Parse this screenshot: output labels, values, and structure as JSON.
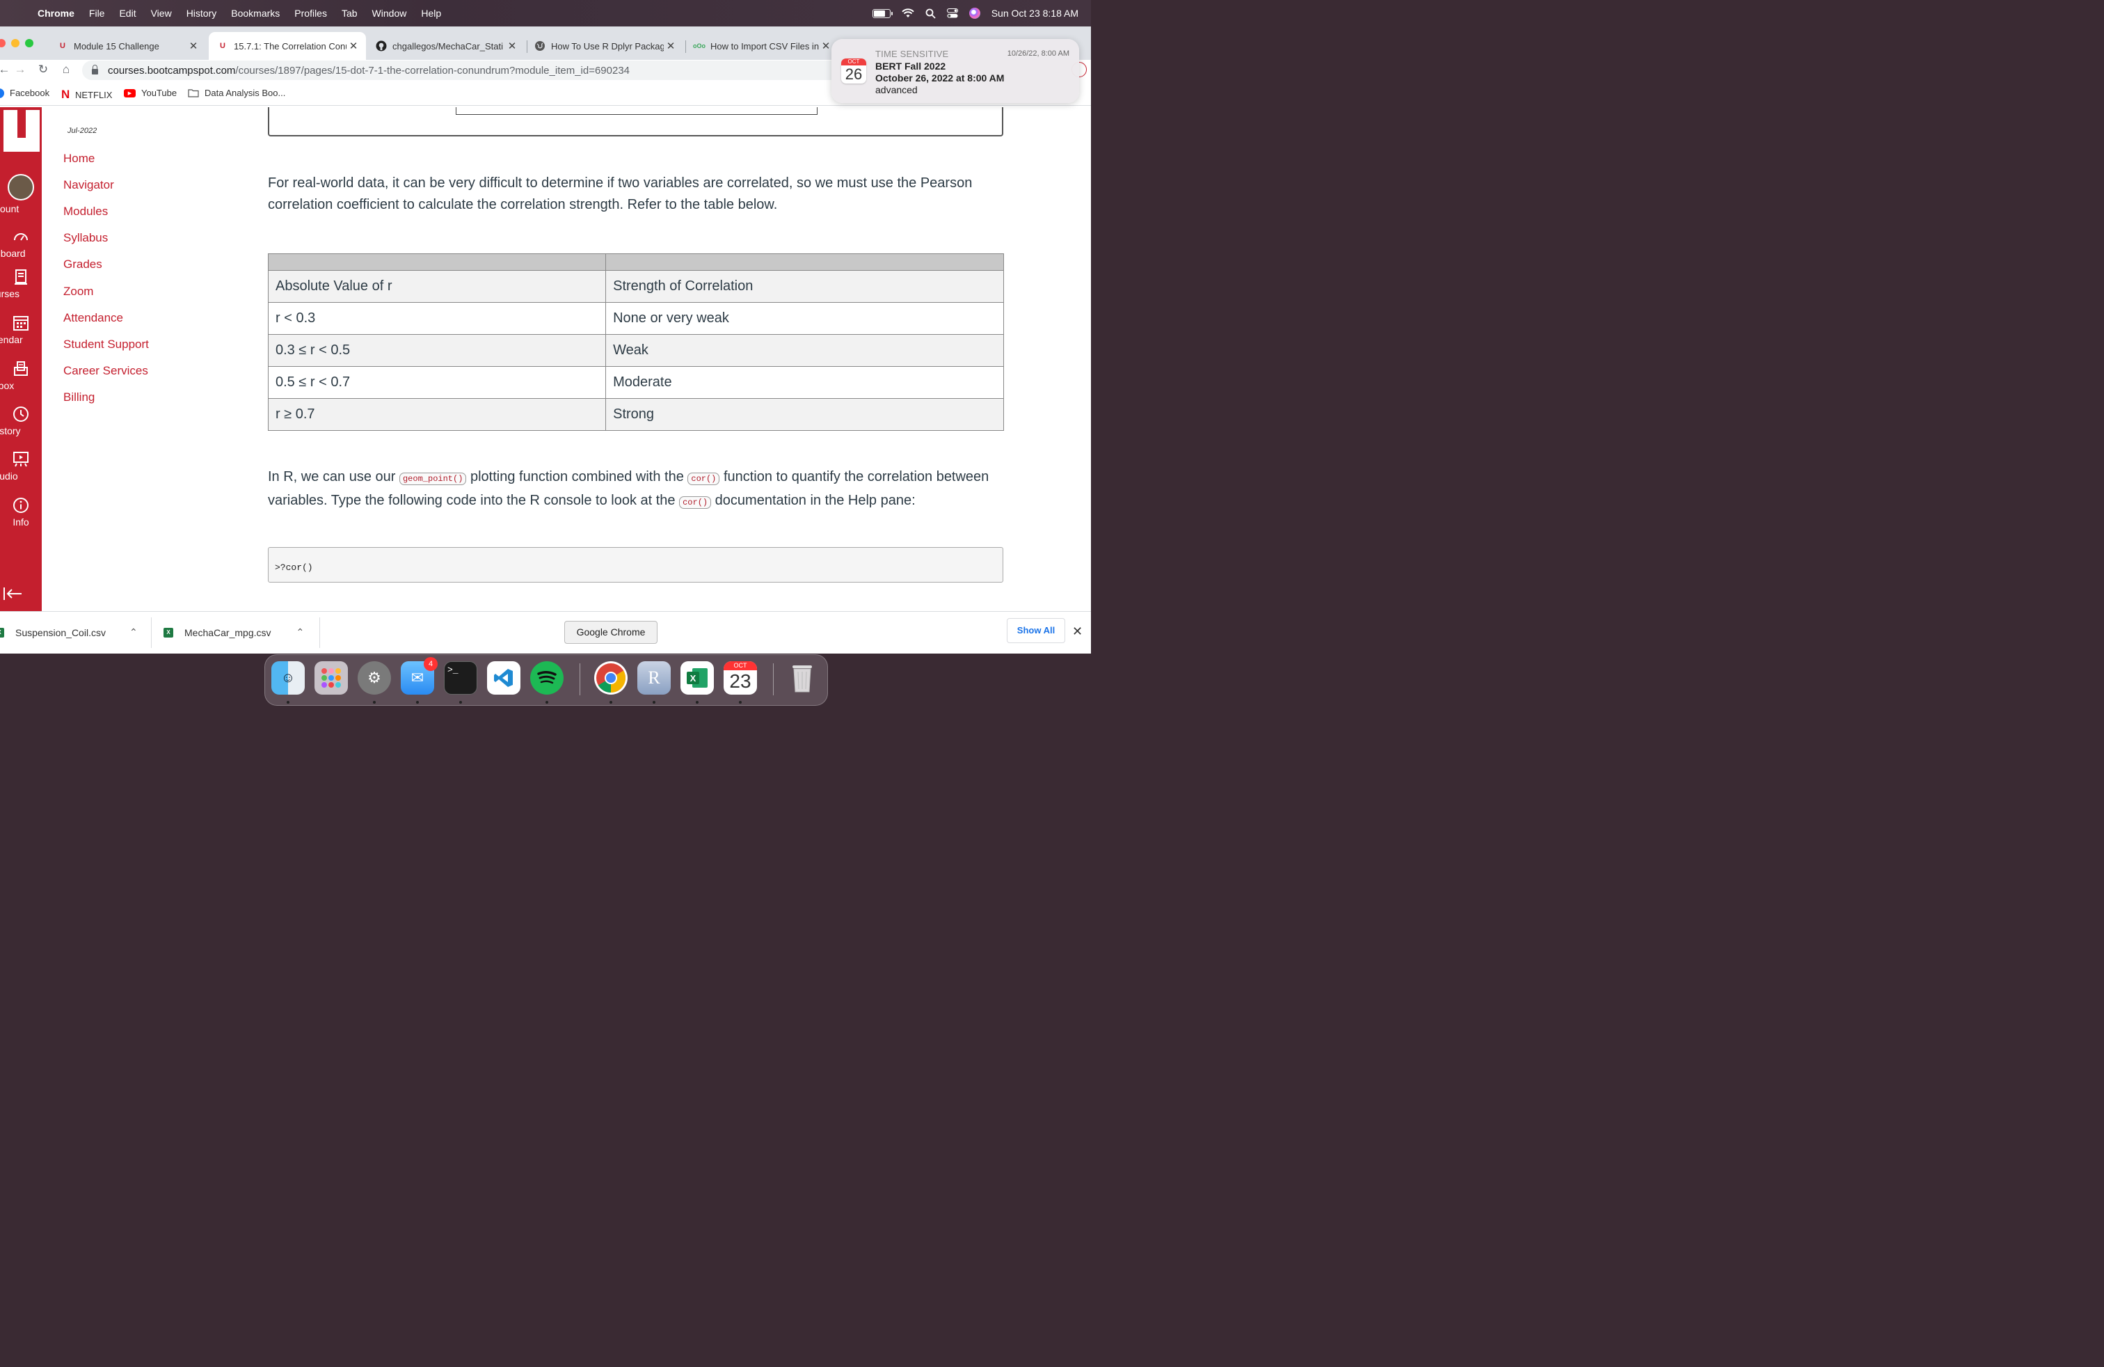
{
  "menubar": {
    "app": "Chrome",
    "items": [
      "File",
      "Edit",
      "View",
      "History",
      "Bookmarks",
      "Profiles",
      "Tab",
      "Window",
      "Help"
    ],
    "datetime": "Sun Oct 23  8:18 AM"
  },
  "tabs": [
    {
      "title": "Module 15 Challenge",
      "icon": "U"
    },
    {
      "title": "15.7.1: The Correlation Conu",
      "icon": "U"
    },
    {
      "title": "chgallegos/MechaCar_Stati",
      "icon": "github-icon"
    },
    {
      "title": "How To Use R Dplyr Packag",
      "icon": "globe-icon"
    },
    {
      "title": "How to Import CSV Files int",
      "icon": "ooo-icon"
    }
  ],
  "address": {
    "domain": "courses.bootcampspot.com",
    "path": "/courses/1897/pages/15-dot-7-1-the-correlation-conundrum?module_item_id=690234"
  },
  "bookmarks": [
    "Facebook",
    "NETFLIX",
    "YouTube",
    "Data Analysis Boo..."
  ],
  "globalnav": [
    "ccount",
    "shboard",
    "ourses",
    "alendar",
    "Inbox",
    "History",
    "Studio",
    "Info"
  ],
  "course": {
    "term": "Jul-2022",
    "links": [
      "Home",
      "Navigator",
      "Modules",
      "Syllabus",
      "Grades",
      "Zoom",
      "Attendance",
      "Student Support",
      "Career Services",
      "Billing"
    ]
  },
  "content": {
    "para1": "For real-world data, it can be very difficult to determine if two variables are correlated, so we must use the Pearson correlation coefficient to calculate the correlation strength. Refer to the table below.",
    "table": {
      "rows": [
        [
          "Absolute Value of r",
          "Strength of Correlation"
        ],
        [
          "r < 0.3",
          "None or very weak"
        ],
        [
          "0.3 ≤ r < 0.5",
          "Weak"
        ],
        [
          "0.5 ≤ r < 0.7",
          "Moderate"
        ],
        [
          "r ≥ 0.7",
          "Strong"
        ]
      ]
    },
    "para2_a": "In R, we can use our ",
    "para2_code1": "geom_point()",
    "para2_b": " plotting function combined with the ",
    "para2_code2": "cor()",
    "para2_c": " function to quantify the correlation between variables. Type the following code into the R console to look at the ",
    "para2_code3": "cor()",
    "para2_d": " documentation in the Help pane:",
    "code": ">?cor()"
  },
  "notification": {
    "label": "TIME SENSITIVE",
    "when": "10/26/22, 8:00 AM",
    "cal_month": "OCT",
    "cal_day": "26",
    "title": "BERT Fall 2022",
    "subtitle": "October 26, 2022 at 8:00 AM",
    "body": "advanced"
  },
  "downloads": [
    "Suspension_Coil.csv",
    "MechaCar_mpg.csv"
  ],
  "show_all": "Show All",
  "tooltip": "Google Chrome",
  "dock": {
    "mail_badge": "4",
    "cal_month": "OCT",
    "cal_day": "23"
  },
  "colors": {
    "canvas_red": "#c41f2e",
    "link_red": "#c41f2e",
    "text": "#2d3b45"
  }
}
